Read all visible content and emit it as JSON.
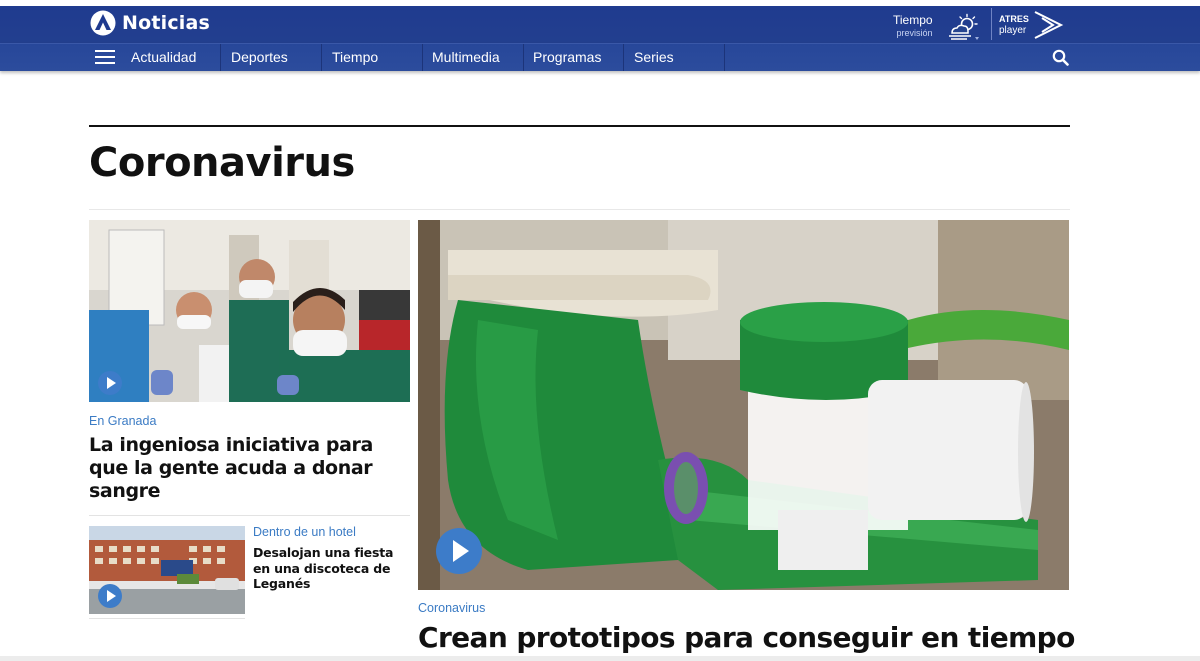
{
  "header": {
    "logo_text": "Noticias",
    "weather": {
      "label": "Tiempo",
      "sublabel": "previsión"
    },
    "atres": {
      "line1": "ATRES",
      "line2": "player"
    }
  },
  "nav": {
    "items": [
      "Actualidad",
      "Deportes",
      "Tiempo",
      "Multimedia",
      "Programas",
      "Series"
    ]
  },
  "section": {
    "title": "Coronavirus"
  },
  "articles": [
    {
      "kicker": "En Granada",
      "headline": "La ingeniosa iniciativa para que la gente acuda a donar sangre",
      "has_video": true
    },
    {
      "kicker": "Dentro de un hotel",
      "headline": "Desalojan una fiesta en una discoteca de Leganés",
      "has_video": true
    },
    {
      "kicker": "Coronavirus",
      "headline": "Crean prototipos para conseguir en tiempo",
      "has_video": true
    }
  ],
  "colors": {
    "header_blue": "#1f3a8f",
    "nav_blue": "#2c4c9c",
    "accent_link": "#3b7bc4",
    "play_button": "#3d7cc9"
  },
  "icons": [
    "logo-icon",
    "menu-icon",
    "weather-icon",
    "atresplayer-icon",
    "search-icon",
    "play-icon"
  ]
}
